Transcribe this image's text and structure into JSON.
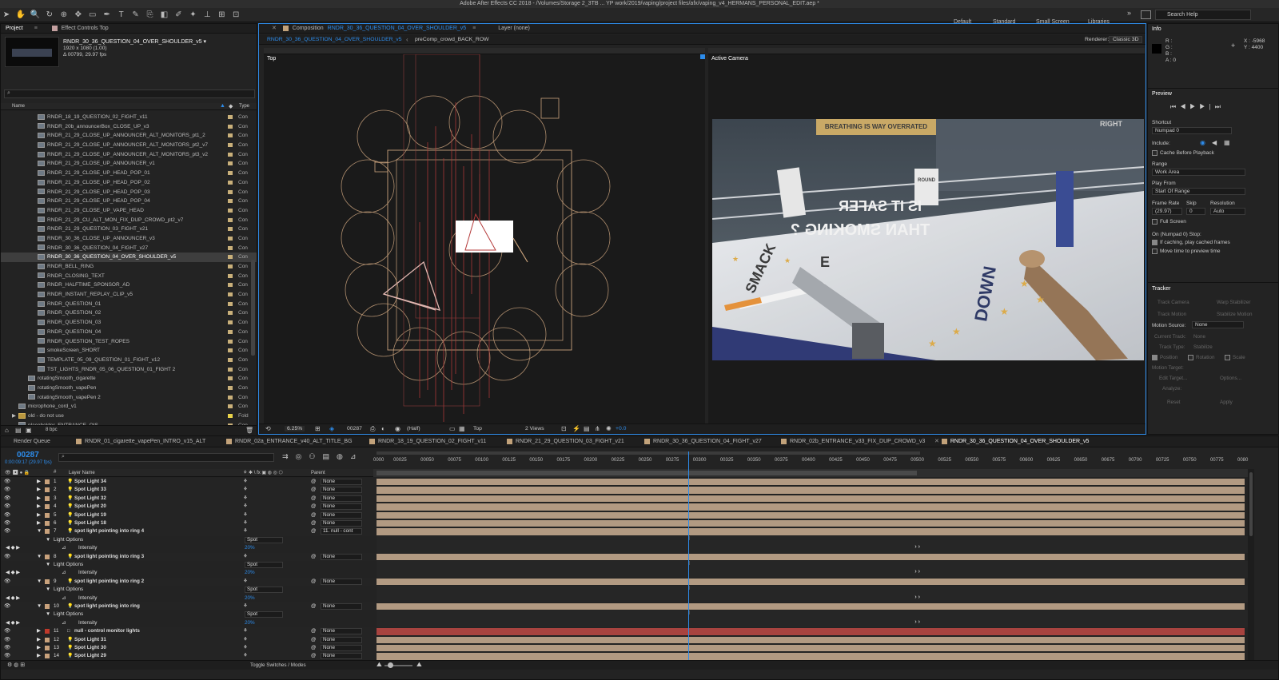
{
  "app": {
    "title": "Adobe After Effects CC 2018 - /Volumes/Storage 2_3TB ... YP work/2019/vaping/project files/afx/vaping_v4_HERMANS_PERSONAL_EDIT.aep *"
  },
  "workspaces": [
    "Default",
    "Standard",
    "Small Screen",
    "Libraries"
  ],
  "search_help": "Search Help",
  "project_panel": {
    "tab_project": "Project",
    "tab_effect_controls": "Effect Controls Top",
    "selected_comp": "RNDR_30_36_QUESTION_04_OVER_SHOULDER_v5 ▾",
    "comp_res": "1920 x 1080 (1.00)",
    "comp_dur": "Δ 00799, 29.97 fps",
    "search_placeholder": "",
    "col_name": "Name",
    "col_type": "Type",
    "bpc": "8 bpc",
    "items": [
      {
        "name": "RNDR_18_19_QUESTION_02_FIGHT_v11",
        "type": "Con"
      },
      {
        "name": "RNDR_20b_announcerBox_CLOSE_UP_v3",
        "type": "Con"
      },
      {
        "name": "RNDR_21_29_CLOSE_UP_ANNOUNCER_ALT_MONITORS_pt1_2",
        "type": "Con"
      },
      {
        "name": "RNDR_21_29_CLOSE_UP_ANNOUNCER_ALT_MONITORS_pt2_v7",
        "type": "Con"
      },
      {
        "name": "RNDR_21_29_CLOSE_UP_ANNOUNCER_ALT_MONITORS_pt3_v2",
        "type": "Con"
      },
      {
        "name": "RNDR_21_29_CLOSE_UP_ANNOUNCER_v1",
        "type": "Con"
      },
      {
        "name": "RNDR_21_29_CLOSE_UP_HEAD_POP_01",
        "type": "Con"
      },
      {
        "name": "RNDR_21_29_CLOSE_UP_HEAD_POP_02",
        "type": "Con"
      },
      {
        "name": "RNDR_21_29_CLOSE_UP_HEAD_POP_03",
        "type": "Con"
      },
      {
        "name": "RNDR_21_29_CLOSE_UP_HEAD_POP_04",
        "type": "Con"
      },
      {
        "name": "RNDR_21_29_CLOSE_UP_VAPE_HEAD",
        "type": "Con"
      },
      {
        "name": "RNDR_21_29_CU_ALT_MON_FIX_DUP_CROWD_pt2_v7",
        "type": "Con"
      },
      {
        "name": "RNDR_21_29_QUESTION_03_FIGHT_v21",
        "type": "Con"
      },
      {
        "name": "RNDR_30_36_CLOSE_UP_ANNOUNCER_v3",
        "type": "Con"
      },
      {
        "name": "RNDR_30_36_QUESTION_04_FIGHT_v27",
        "type": "Con"
      },
      {
        "name": "RNDR_30_36_QUESTION_04_OVER_SHOULDER_v5",
        "type": "Con",
        "selected": true
      },
      {
        "name": "RNDR_BELL_RING",
        "type": "Con"
      },
      {
        "name": "RNDR_CLOSING_TEXT",
        "type": "Con"
      },
      {
        "name": "RNDR_HALFTIME_SPONSOR_AD",
        "type": "Con"
      },
      {
        "name": "RNDR_INSTANT_REPLAY_CLIP_v5",
        "type": "Con"
      },
      {
        "name": "RNDR_QUESTION_01",
        "type": "Con"
      },
      {
        "name": "RNDR_QUESTION_02",
        "type": "Con"
      },
      {
        "name": "RNDR_QUESTION_03",
        "type": "Con"
      },
      {
        "name": "RNDR_QUESTION_04",
        "type": "Con"
      },
      {
        "name": "RNDR_QUESTION_TEST_ROPES",
        "type": "Con"
      },
      {
        "name": "smokeScreen_SHORT",
        "type": "Con"
      },
      {
        "name": "TEMPLATE_05_09_QUESTION_01_FIGHT_v12",
        "type": "Con"
      },
      {
        "name": "TST_LIGHTS_RNDR_05_06_QUESTION_01_FIGHT 2",
        "type": "Con"
      },
      {
        "name": "rotatingSmooth_cigarette",
        "type": "Con"
      },
      {
        "name": "rotatingSmooth_vapePen",
        "type": "Con"
      },
      {
        "name": "rotatingSmooth_vapePen 2",
        "type": "Con"
      },
      {
        "name": "microphone_cord_v1",
        "type": "Con"
      },
      {
        "name": "old - do not use",
        "type": "Fold"
      },
      {
        "name": "placeholder_ENTRANCE_OIS",
        "type": "Con"
      }
    ]
  },
  "composition_panel": {
    "tab_comp_prefix": "Composition",
    "tab_comp_name": "RNDR_30_36_QUESTION_04_OVER_SHOULDER_v5",
    "tab_layer": "Layer (none)",
    "breadcrumb_1": "RNDR_30_36_QUESTION_04_OVER_SHOULDER_v5",
    "breadcrumb_2": "preComp_crowd_BACK_ROW",
    "renderer_label": "Renderer:",
    "renderer_value": "Classic 3D",
    "view_left_label": "Top",
    "view_right_label": "Active Camera",
    "zoom": "6.25%",
    "frame": "00287",
    "resolution": "(Half)",
    "view_select": "Top",
    "views_select": "2 Views",
    "exposure": "+0.0",
    "scene_texts": {
      "banner": "BREATHING IS WAY OVERRATED",
      "round": "ROUND",
      "mirrored_line1": "IS IT SAFER",
      "mirrored_line2": "THAN SMOKING ?",
      "mat_down": "DOWN",
      "mat_smack": "SMACK",
      "mat_e": "E",
      "right_banner": "RIGHT"
    }
  },
  "info_panel": {
    "title": "Info",
    "r": "R :",
    "g": "G :",
    "b": "B :",
    "a": "A : 0",
    "x": "X : -5968",
    "y": "Y : 4400"
  },
  "preview_panel": {
    "title": "Preview",
    "shortcut_label": "Shortcut",
    "shortcut_value": "Numpad 0",
    "include_label": "Include:",
    "cache_before": "Cache Before Playback",
    "range_label": "Range",
    "range_value": "Work Area",
    "play_from_label": "Play From",
    "play_from_value": "Start Of Range",
    "frame_rate_label": "Frame Rate",
    "skip_label": "Skip",
    "resolution_label": "Resolution",
    "frame_rate_value": "(29.97)",
    "skip_value": "0",
    "resolution_value": "Auto",
    "full_screen": "Full Screen",
    "on_stop": "On (Numpad 0) Stop:",
    "if_caching": "If caching, play cached frames",
    "move_time": "Move time to preview time"
  },
  "tracker_panel": {
    "title": "Tracker",
    "track_camera": "Track Camera",
    "warp_stabilizer": "Warp Stabilizer",
    "track_motion": "Track Motion",
    "stabilize_motion": "Stabilize Motion",
    "motion_source_label": "Motion Source:",
    "motion_source_value": "None",
    "current_track_label": "Current Track:",
    "current_track_value": "None",
    "track_type_label": "Track Type:",
    "track_type_value": "Stabilize",
    "position": "Position",
    "rotation": "Rotation",
    "scale": "Scale",
    "motion_target": "Motion Target:",
    "edit_target": "Edit Target...",
    "options": "Options...",
    "analyze": "Analyze:",
    "reset": "Reset",
    "apply": "Apply"
  },
  "timeline": {
    "tabs": [
      {
        "label": "Render Queue"
      },
      {
        "label": "RNDR_01_cigarette_vapePen_INTRO_v15_ALT"
      },
      {
        "label": "RNDR_02a_ENTRANCE_v40_ALT_TITLE_BG"
      },
      {
        "label": "RNDR_18_19_QUESTION_02_FIGHT_v11"
      },
      {
        "label": "RNDR_21_29_QUESTION_03_FIGHT_v21"
      },
      {
        "label": "RNDR_30_36_QUESTION_04_FIGHT_v27"
      },
      {
        "label": "RNDR_02b_ENTRANCE_v33_FIX_DUP_CROWD_v3"
      },
      {
        "label": "RNDR_30_36_QUESTION_04_OVER_SHOULDER_v5",
        "active": true
      }
    ],
    "current_time": "00287",
    "current_time_sub": "0:00:09:17 (29.97 fps)",
    "col_layer_name": "Layer Name",
    "col_parent": "Parent",
    "toggle_label": "Toggle Switches / Modes",
    "ruler_ticks": [
      "0000",
      "00025",
      "00050",
      "00075",
      "00100",
      "00125",
      "00150",
      "00175",
      "00200",
      "00225",
      "00250",
      "00275",
      "00300",
      "00325",
      "00350",
      "00375",
      "00400",
      "00425",
      "00450",
      "00475",
      "00500",
      "00525",
      "00550",
      "00575",
      "00600",
      "00625",
      "00650",
      "00675",
      "00700",
      "00725",
      "00750",
      "00775",
      "0080"
    ],
    "playhead_fraction": 0.359,
    "work_area_end_fraction": 0.62,
    "rows": [
      {
        "kind": "layer",
        "num": "1",
        "name": "Spot Light 34",
        "parent": "None"
      },
      {
        "kind": "layer",
        "num": "2",
        "name": "Spot Light 33",
        "parent": "None"
      },
      {
        "kind": "layer",
        "num": "3",
        "name": "Spot Light 32",
        "parent": "None"
      },
      {
        "kind": "layer",
        "num": "4",
        "name": "Spot Light 20",
        "parent": "None"
      },
      {
        "kind": "layer",
        "num": "5",
        "name": "Spot Light 19",
        "parent": "None"
      },
      {
        "kind": "layer",
        "num": "6",
        "name": "Spot Light 18",
        "parent": "None"
      },
      {
        "kind": "layer",
        "num": "7",
        "name": "spot light pointing into ring 4",
        "parent": "11. null - cont"
      },
      {
        "kind": "group",
        "name": "Light Options",
        "value": "Spot"
      },
      {
        "kind": "prop",
        "name": "Intensity",
        "value": "20%"
      },
      {
        "kind": "layer",
        "num": "8",
        "name": "spot light pointing into ring 3",
        "parent": "None"
      },
      {
        "kind": "group",
        "name": "Light Options",
        "value": "Spot"
      },
      {
        "kind": "prop",
        "name": "Intensity",
        "value": "20%"
      },
      {
        "kind": "layer",
        "num": "9",
        "name": "spot light pointing into ring 2",
        "parent": "None"
      },
      {
        "kind": "group",
        "name": "Light Options",
        "value": "Spot"
      },
      {
        "kind": "prop",
        "name": "Intensity",
        "value": "20%"
      },
      {
        "kind": "layer",
        "num": "10",
        "name": "spot light pointing into ring",
        "parent": "None"
      },
      {
        "kind": "group",
        "name": "Light Options",
        "value": "Spot"
      },
      {
        "kind": "prop",
        "name": "Intensity",
        "value": "20%"
      },
      {
        "kind": "layer",
        "num": "11",
        "name": "null - control monitor lights",
        "parent": "None",
        "red": true
      },
      {
        "kind": "layer",
        "num": "12",
        "name": "Spot Light 31",
        "parent": "None"
      },
      {
        "kind": "layer",
        "num": "13",
        "name": "Spot Light 30",
        "parent": "None"
      },
      {
        "kind": "layer",
        "num": "14",
        "name": "Spot Light 29",
        "parent": "None"
      }
    ]
  },
  "colors": {
    "accent_blue": "#2d8ceb",
    "layer_bar": "#b29a82",
    "null_bar": "#a8433f",
    "panel_bg": "#232323"
  }
}
